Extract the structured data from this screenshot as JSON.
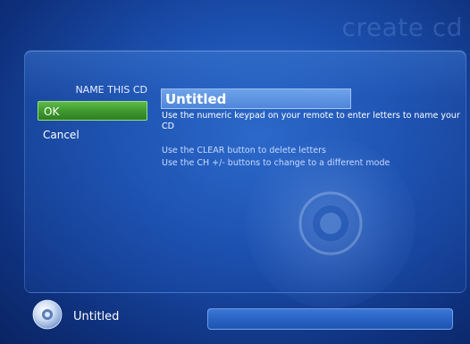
{
  "header": {
    "title": "create cd"
  },
  "sidebar": {
    "heading": "NAME THIS CD",
    "items": [
      {
        "label": "OK",
        "selected": true
      },
      {
        "label": "Cancel",
        "selected": false
      }
    ]
  },
  "main": {
    "name_field": {
      "value": "Untitled"
    },
    "help_lines": [
      "Use the numeric keypad on your remote to enter letters to name your CD",
      "Use the CLEAR button to delete letters",
      "Use the CH +/- buttons to change to a different mode"
    ]
  },
  "footer": {
    "disc_title": "Untitled",
    "progress_fraction": 0,
    "disc_icon": "cd-icon"
  },
  "colors": {
    "accent_green": "#3f9a2f",
    "background_blue": "#1b4fae",
    "field_blue": "#5f94e0"
  }
}
